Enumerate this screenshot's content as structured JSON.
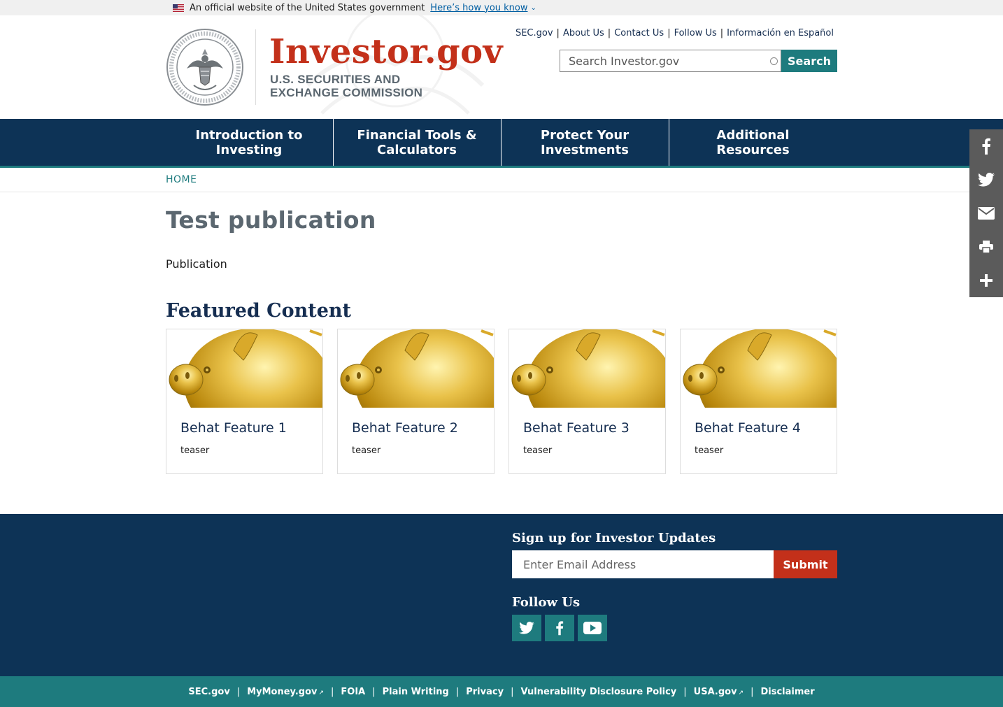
{
  "gov_banner": {
    "text": "An official website of the United States government",
    "link": "Here’s how you know"
  },
  "header": {
    "logo_title": "Investor.gov",
    "logo_sub_line1": "U.S. SECURITIES AND",
    "logo_sub_line2": "EXCHANGE COMMISSION",
    "utility_links": [
      "SEC.gov",
      "About Us",
      "Contact Us",
      "Follow Us",
      "Información en Español"
    ],
    "search_placeholder": "Search Investor.gov",
    "search_button": "Search"
  },
  "nav": {
    "items": [
      {
        "line1": "Introduction to",
        "line2": "Investing"
      },
      {
        "line1": "Financial Tools &",
        "line2": "Calculators"
      },
      {
        "line1": "Protect Your",
        "line2": "Investments"
      },
      {
        "line1": "Additional",
        "line2": "Resources"
      }
    ]
  },
  "breadcrumb": "HOME",
  "main": {
    "title": "Test publication",
    "label": "Publication",
    "featured_title": "Featured Content",
    "cards": [
      {
        "title": "Behat Feature 1",
        "teaser": "teaser"
      },
      {
        "title": "Behat Feature 2",
        "teaser": "teaser"
      },
      {
        "title": "Behat Feature 3",
        "teaser": "teaser"
      },
      {
        "title": "Behat Feature 4",
        "teaser": "teaser"
      }
    ]
  },
  "share_icons": [
    "facebook-icon",
    "twitter-icon",
    "email-icon",
    "print-icon",
    "plus-icon"
  ],
  "footer": {
    "signup_title": "Sign up for Investor Updates",
    "email_placeholder": "Enter Email Address",
    "submit": "Submit",
    "follow_title": "Follow Us",
    "social_icons": [
      "twitter-icon",
      "facebook-icon",
      "youtube-icon"
    ],
    "bottom_links": [
      "SEC.gov",
      "MyMoney.gov",
      "FOIA",
      "Plain Writing",
      "Privacy",
      "Vulnerability Disclosure Policy",
      "USA.gov",
      "Disclaimer"
    ]
  },
  "colors": {
    "navy": "#0d3356",
    "teal": "#1e7b7e",
    "red": "#c3301a",
    "share_gray": "#5b5b5b"
  }
}
